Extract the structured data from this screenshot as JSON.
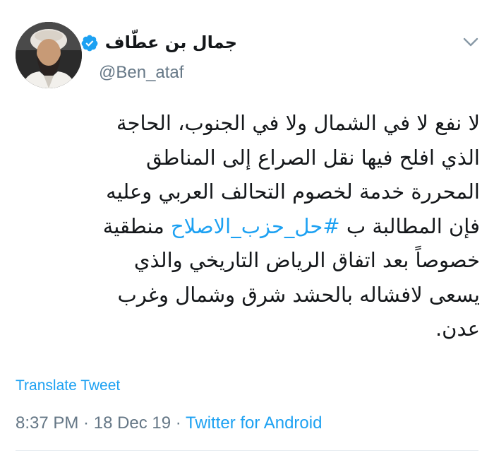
{
  "tweet": {
    "display_name": "جمال بن عطّاف",
    "handle": "@Ben_ataf",
    "verified": true,
    "text_lines": [
      "لا نفع لا في الشمال ولا في الجنوب، الحاجة",
      "الذي افلح فيها نقل الصراع إلى المناطق",
      "المحررة خدمة لخصوم التحالف العربي وعليه"
    ],
    "line4_before": "فإن المطالبة ب ",
    "hashtag": "#حل_حزب_الاصلاح",
    "line4_after": " منطقية",
    "text_lines_end": [
      "خصوصاً بعد اتفاق الرياض التاريخي والذي",
      "يسعى لافشاله بالحشد شرق وشمال وغرب",
      "عدن."
    ],
    "translate_label": "Translate Tweet",
    "time": "8:37 PM",
    "date": "18 Dec 19",
    "separator": " · ",
    "source": "Twitter for Android"
  },
  "colors": {
    "accent": "#1da1f2",
    "secondary_text": "#657786",
    "primary_text": "#14171a",
    "divider": "#e6ecf0"
  },
  "icons": {
    "verified": "verified-badge-icon",
    "caret": "chevron-down-icon",
    "avatar": "user-avatar"
  }
}
